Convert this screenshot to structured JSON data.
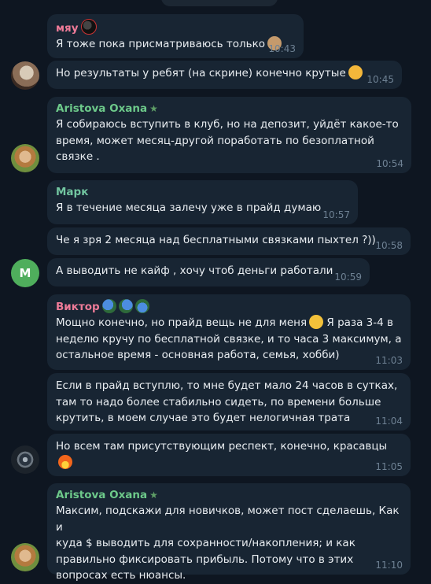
{
  "top_pill": "",
  "messages": [
    {
      "sender": "мяу",
      "sender_color": "#ee7b98",
      "text": "Я тоже пока присматриваюсь только",
      "time": "10:43",
      "emoji_after_name": "bowling-ball-icon",
      "emoji_after_text": "monkey-icon"
    },
    {
      "text": "Но результаты у ребят (на скрине) конечно крутые",
      "time": "10:45",
      "emoji_after_text": "smiling-face-with-hearts-icon"
    },
    {
      "sender": "Aristova Oxana",
      "sender_color": "#6dc98a",
      "badge": "★",
      "text": "Я собираюсь вступить в клуб, но на депозит, уйдёт какое-то\nвремя, может месяц-другой поработать по безоплатной\nсвязке .",
      "time": "10:54"
    },
    {
      "sender": "Марк",
      "sender_color": "#72c5a0",
      "text": "Я в течение месяца залечу уже в прайд думаю",
      "time": "10:57"
    },
    {
      "text": "Че я зря 2 месяца над бесплатными связками пыхтел ?))",
      "time": "10:58"
    },
    {
      "text": "А выводить не кайф , хочу чтоб деньги работали",
      "time": "10:59",
      "avatar_letter": "M"
    },
    {
      "sender": "Виктор",
      "sender_color": "#ee7b98",
      "text": "Мощно конечно, но прайд вещь не для меня",
      "text_rest": " Я раза 3-4 в\nнеделю кручу по бесплатной связке, и то часа 3 максимум, а\nостальное время - основная работа, семья, хобби)",
      "time": "11:03",
      "emoji_after_name": "globe-icons",
      "emoji_after_text": "grinning-face-icon"
    },
    {
      "text": "Если в прайд вступлю, то мне будет мало 24 часов в сутках,\nтам то надо более стабильно сидеть, по времени больше\nкрутить, в моем случае это будет нелогичная трата",
      "time": "11:04"
    },
    {
      "text": "Но всем там присутствующим респект, конечно, красавцы",
      "time": "11:05",
      "emoji_after_text": "fire-icon"
    },
    {
      "sender": "Aristova Oxana",
      "sender_color": "#6dc98a",
      "badge": "★",
      "text": "Максим, подскажи для новичков, может пост сделаешь, Как и\nкуда $ выводить для сохранности/накопления; и как\nправильно фиксировать прибыль. Потому что в этих\nвопросах есть нюансы.",
      "time": "11:10"
    }
  ],
  "colors": {
    "background": "#0e1621",
    "bubble": "#182533",
    "time": "#6e8193",
    "avatar_m": "#4fae5c"
  }
}
